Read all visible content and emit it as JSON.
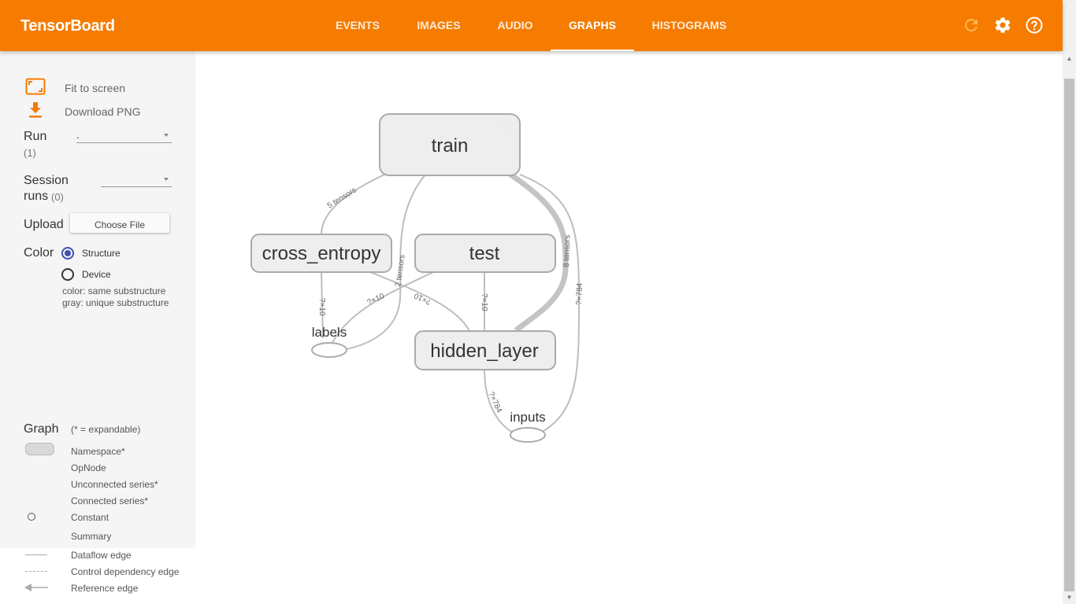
{
  "header": {
    "title": "TensorBoard",
    "tabs": [
      {
        "label": "EVENTS"
      },
      {
        "label": "IMAGES"
      },
      {
        "label": "AUDIO"
      },
      {
        "label": "GRAPHS"
      },
      {
        "label": "HISTOGRAMS"
      }
    ],
    "active_tab": "GRAPHS",
    "icons": [
      "refresh-icon",
      "settings-icon",
      "help-icon"
    ],
    "accent_color": "#f57c00"
  },
  "sidebar": {
    "fit_to_screen": "Fit to screen",
    "download_png": "Download PNG",
    "run_label": "Run",
    "run_count": "(1)",
    "run_value": ".",
    "session_label_1": "Session",
    "session_label_2": "runs",
    "session_count": "(0)",
    "upload_label": "Upload",
    "choose_file": "Choose File",
    "color_label": "Color",
    "color_structure": "Structure",
    "color_device": "Device",
    "color_selected": "Structure",
    "color_note_1": "color: same substructure",
    "color_note_2": "gray: unique substructure",
    "legend": {
      "title": "Graph",
      "expandable_note": "(* = expandable)",
      "namespace": "Namespace*",
      "opnode": "OpNode",
      "unconnected": "Unconnected series*",
      "connected": "Connected series*",
      "constant": "Constant",
      "summary": "Summary",
      "dataflow": "Dataflow edge",
      "control": "Control dependency edge",
      "reference": "Reference edge"
    }
  },
  "graph": {
    "nodes": {
      "train": "train",
      "cross_entropy": "cross_entropy",
      "test": "test",
      "hidden_layer": "hidden_layer",
      "labels": "labels",
      "inputs": "inputs"
    },
    "edge_labels": {
      "train_cross": "5 tensors",
      "train_labels": "2 tensors",
      "train_hidden": "8 tensors",
      "train_inputs": "?×784",
      "cross_labels": "?×10",
      "labels_test": "?×10",
      "cross_hidden": "?×10",
      "test_hidden": "?×10",
      "hidden_inputs": "?×784"
    },
    "edge_color": "#bdbdbd",
    "node_fill": "#eeeeee",
    "node_stroke": "#aaaaaa"
  }
}
